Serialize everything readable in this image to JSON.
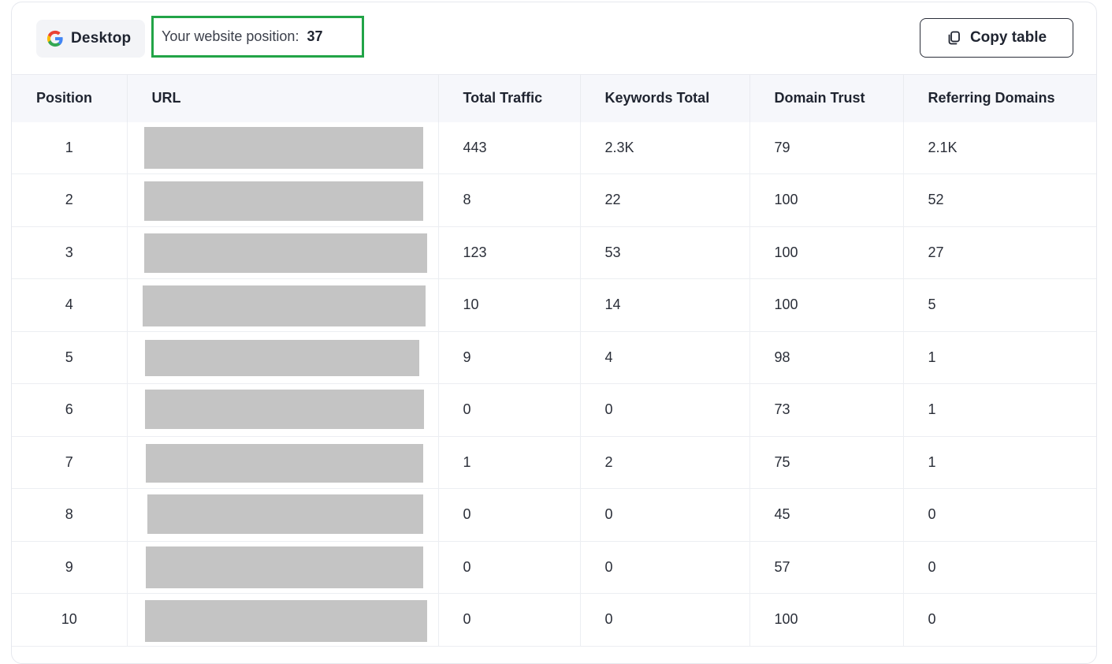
{
  "toolbar": {
    "device_label": "Desktop",
    "position_label": "Your website position:",
    "position_value": "37",
    "copy_label": "Copy table",
    "position_highlight_color": "#22a447"
  },
  "table": {
    "columns": [
      "Position",
      "URL",
      "Total Traffic",
      "Keywords Total",
      "Domain Trust",
      "Referring Domains"
    ],
    "rows": [
      {
        "position": "1",
        "url": "",
        "traffic": "443",
        "keywords": "2.3K",
        "trust": "79",
        "ref_domains": "2.1K"
      },
      {
        "position": "2",
        "url": "",
        "traffic": "8",
        "keywords": "22",
        "trust": "100",
        "ref_domains": "52"
      },
      {
        "position": "3",
        "url": "",
        "traffic": "123",
        "keywords": "53",
        "trust": "100",
        "ref_domains": "27"
      },
      {
        "position": "4",
        "url": "",
        "traffic": "10",
        "keywords": "14",
        "trust": "100",
        "ref_domains": "5"
      },
      {
        "position": "5",
        "url": "",
        "traffic": "9",
        "keywords": "4",
        "trust": "98",
        "ref_domains": "1"
      },
      {
        "position": "6",
        "url": "",
        "traffic": "0",
        "keywords": "0",
        "trust": "73",
        "ref_domains": "1"
      },
      {
        "position": "7",
        "url": "",
        "traffic": "1",
        "keywords": "2",
        "trust": "75",
        "ref_domains": "1"
      },
      {
        "position": "8",
        "url": "",
        "traffic": "0",
        "keywords": "0",
        "trust": "45",
        "ref_domains": "0"
      },
      {
        "position": "9",
        "url": "",
        "traffic": "0",
        "keywords": "0",
        "trust": "57",
        "ref_domains": "0"
      },
      {
        "position": "10",
        "url": "",
        "traffic": "0",
        "keywords": "0",
        "trust": "100",
        "ref_domains": "0"
      }
    ]
  },
  "icons": {
    "device": "google-icon",
    "copy": "copy-icon"
  }
}
